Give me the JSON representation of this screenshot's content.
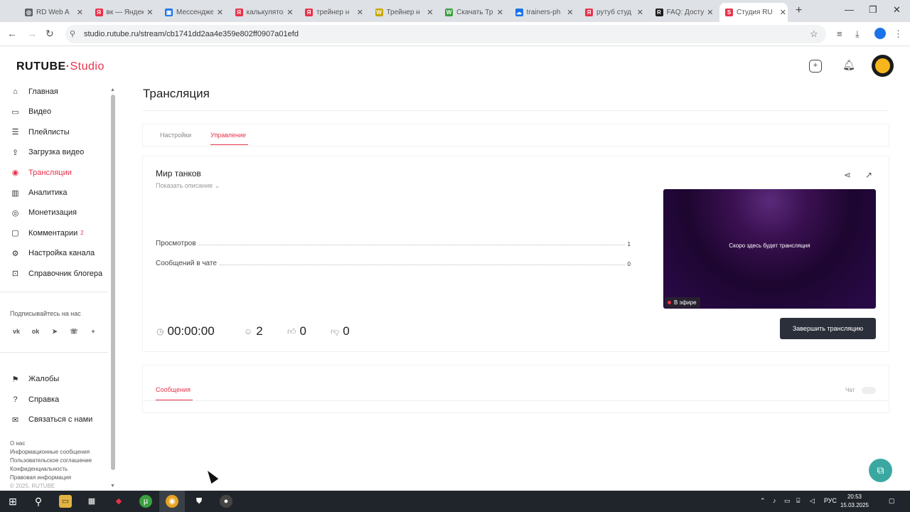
{
  "browser": {
    "tabs": [
      {
        "title": "RD Web A",
        "icon": "globe-icon",
        "color": "#5f6368",
        "glyph": "◎"
      },
      {
        "title": "вк — Яндекс",
        "icon": "yandex-icon",
        "color": "#e8324b",
        "glyph": "Я"
      },
      {
        "title": "Мессенджер",
        "icon": "messenger-icon",
        "color": "#1a73e8",
        "glyph": "▣"
      },
      {
        "title": "калькулятор",
        "icon": "yandex-icon",
        "color": "#e8324b",
        "glyph": "Я"
      },
      {
        "title": "трейнер н",
        "icon": "yandex-icon",
        "color": "#e8324b",
        "glyph": "Я"
      },
      {
        "title": "Трейнер н",
        "icon": "w-icon",
        "color": "#c8a500",
        "glyph": "W"
      },
      {
        "title": "Скачать Тр",
        "icon": "w-icon",
        "color": "#3aa040",
        "glyph": "W"
      },
      {
        "title": "trainers-ph",
        "icon": "cloud-icon",
        "color": "#1a73e8",
        "glyph": "☁"
      },
      {
        "title": "рутуб студ",
        "icon": "yandex-icon",
        "color": "#e8324b",
        "glyph": "Я"
      },
      {
        "title": "FAQ: Досту",
        "icon": "rutube-icon",
        "color": "#1b1b1b",
        "glyph": "R"
      },
      {
        "title": "Студия RU",
        "icon": "rutube-studio-icon",
        "color": "#e8324b",
        "glyph": "S"
      }
    ],
    "url": "studio.rutube.ru/stream/cb1741dd2aa4e359e802ff0907a01efd"
  },
  "header": {
    "logo_main": "RUTUBE",
    "logo_studio": "Studio"
  },
  "sidebar": {
    "items": [
      {
        "label": "Главная",
        "icon": "home-icon",
        "glyph": "⌂"
      },
      {
        "label": "Видео",
        "icon": "video-icon",
        "glyph": "▭"
      },
      {
        "label": "Плейлисты",
        "icon": "playlist-icon",
        "glyph": "☰"
      },
      {
        "label": "Загрузка видео",
        "icon": "upload-icon",
        "glyph": "⇪"
      },
      {
        "label": "Трансляции",
        "icon": "broadcast-icon",
        "glyph": "◉"
      },
      {
        "label": "Аналитика",
        "icon": "analytics-icon",
        "glyph": "▥"
      },
      {
        "label": "Монетизация",
        "icon": "monetization-icon",
        "glyph": "◎"
      },
      {
        "label": "Комментарии",
        "icon": "comments-icon",
        "glyph": "▢",
        "badge": "2"
      },
      {
        "label": "Настройка канала",
        "icon": "settings-icon",
        "glyph": "⚙"
      },
      {
        "label": "Справочник блогера",
        "icon": "guide-icon",
        "glyph": "⊡"
      }
    ],
    "subscribe_title": "Подписывайтесь на нас",
    "socials": [
      {
        "icon": "vk-icon",
        "glyph": "vk"
      },
      {
        "icon": "ok-icon",
        "glyph": "ok"
      },
      {
        "icon": "telegram-icon",
        "glyph": "➤"
      },
      {
        "icon": "viber-icon",
        "glyph": "☏"
      },
      {
        "icon": "more-icon",
        "glyph": "+"
      }
    ],
    "bottom_items": [
      {
        "label": "Жалобы",
        "icon": "flag-icon",
        "glyph": "⚑"
      },
      {
        "label": "Справка",
        "icon": "help-icon",
        "glyph": "?"
      },
      {
        "label": "Связаться с нами",
        "icon": "mail-icon",
        "glyph": "✉"
      }
    ],
    "footer_links": [
      "О нас",
      "Информационные сообщения",
      "Пользовательское соглашение",
      "Конфиденциальность",
      "Правовая информация",
      "© 2025, RUTUBE"
    ]
  },
  "main": {
    "page_title": "Трансляция",
    "tabs": [
      "Настройки",
      "Управление"
    ],
    "active_tab": "Управление",
    "stream": {
      "name": "Мир танков",
      "show_description": "Показать описание",
      "stats": [
        {
          "label": "Просмотров",
          "value": "1"
        },
        {
          "label": "Сообщений в чате",
          "value": "0"
        }
      ],
      "timer": "00:00:00",
      "viewers": "2",
      "likes": "0",
      "dislikes": "0",
      "preview_text": "Скоро здесь будет трансляция",
      "live_label": "В эфире",
      "end_button": "Завершить трансляцию"
    },
    "messages": {
      "tab": "Сообщения",
      "chat_label": "Чат"
    }
  },
  "taskbar": {
    "lang": "РУС",
    "time": "20:53",
    "date": "15.03.2025"
  },
  "colors": {
    "accent": "#e8324b",
    "button_dark": "#2b2f3a",
    "support": "#3aa8a0"
  }
}
